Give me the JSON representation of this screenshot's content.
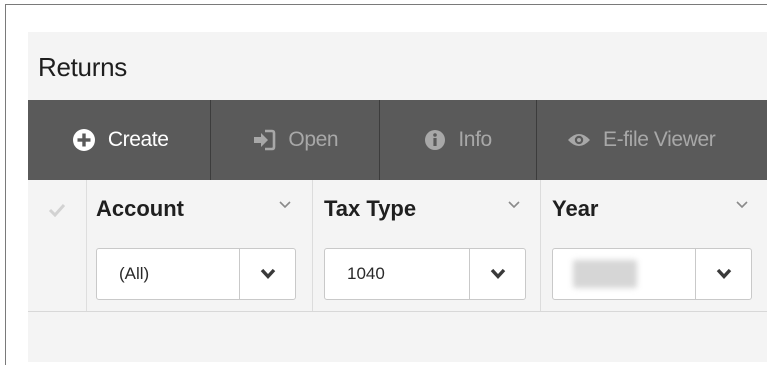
{
  "page": {
    "title": "Returns"
  },
  "toolbar": {
    "create_label": "Create",
    "open_label": "Open",
    "info_label": "Info",
    "efile_label": "E-file Viewer"
  },
  "columns": {
    "account": {
      "title": "Account",
      "filter_value": "(All)"
    },
    "tax_type": {
      "title": "Tax Type",
      "filter_value": "1040"
    },
    "year": {
      "title": "Year",
      "filter_value": ""
    }
  },
  "icons": {
    "create": "plus-circle-icon",
    "open": "sign-in-icon",
    "info": "info-circle-icon",
    "efile": "eye-icon",
    "select_all": "check-icon",
    "column_menu": "chevron-down-icon",
    "dropdown": "chevron-down-icon"
  },
  "colors": {
    "toolbar_bg": "#5a5a5a",
    "toolbar_text": "#ffffff",
    "toolbar_disabled_text": "#a8a8a8",
    "panel_bg": "#f4f4f4"
  }
}
